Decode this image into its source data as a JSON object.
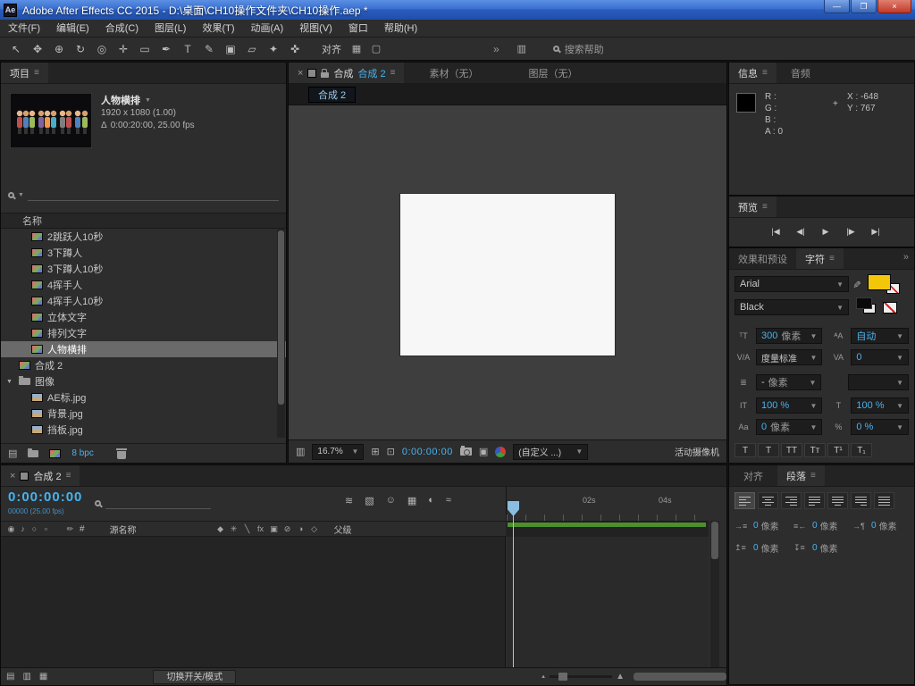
{
  "icons": {
    "menu": "≡",
    "dropdown": "▼",
    "overflow": "»",
    "delta": "Δ",
    "crosshair": "+"
  },
  "titlebar": {
    "app_badge": "Ae",
    "title": "Adobe After Effects CC 2015 - D:\\桌面\\CH10操作文件夹\\CH10操作.aep *",
    "minimize": "—",
    "maximize": "❐",
    "close": "×"
  },
  "menubar": {
    "items": [
      "文件(F)",
      "编辑(E)",
      "合成(C)",
      "图层(L)",
      "效果(T)",
      "动画(A)",
      "视图(V)",
      "窗口",
      "帮助(H)"
    ]
  },
  "toolbar": {
    "tools": [
      {
        "name": "selection-tool",
        "glyph": "↖"
      },
      {
        "name": "hand-tool",
        "glyph": "✥"
      },
      {
        "name": "zoom-tool",
        "glyph": "⊕"
      },
      {
        "name": "rotation-tool",
        "glyph": "↻"
      },
      {
        "name": "unified-camera-tool",
        "glyph": "◎"
      },
      {
        "name": "pan-behind-tool",
        "glyph": "✛"
      },
      {
        "name": "shape-tool",
        "glyph": "▭"
      },
      {
        "name": "pen-tool",
        "glyph": "✒"
      },
      {
        "name": "type-tool",
        "glyph": "T"
      },
      {
        "name": "brush-tool",
        "glyph": "✎"
      },
      {
        "name": "clone-stamp-tool",
        "glyph": "▣"
      },
      {
        "name": "eraser-tool",
        "glyph": "▱"
      },
      {
        "name": "roto-brush-tool",
        "glyph": "✦"
      },
      {
        "name": "puppet-pin-tool",
        "glyph": "✜"
      }
    ],
    "align_label": "对齐",
    "right_icons": [
      {
        "name": "grid-icon",
        "glyph": "▦"
      },
      {
        "name": "guides-icon",
        "glyph": "▢"
      }
    ],
    "workspace_icon": "▥",
    "search_text": "搜索帮助"
  },
  "project": {
    "tab": "项目",
    "preview": {
      "name": "人物横排",
      "dims": "1920 x 1080 (1.00)",
      "duration": "0:00:20:00, 25.00 fps"
    },
    "name_column": "名称",
    "items": [
      {
        "name": "2跳跃人10秒",
        "type": "comp",
        "indent": 1
      },
      {
        "name": "3下蹲人",
        "type": "comp",
        "indent": 1
      },
      {
        "name": "3下蹲人10秒",
        "type": "comp",
        "indent": 1
      },
      {
        "name": "4挥手人",
        "type": "comp",
        "indent": 1
      },
      {
        "name": "4挥手人10秒",
        "type": "comp",
        "indent": 1
      },
      {
        "name": "立体文字",
        "type": "comp",
        "indent": 1
      },
      {
        "name": "排列文字",
        "type": "comp",
        "indent": 1
      },
      {
        "name": "人物横排",
        "type": "comp",
        "indent": 1,
        "selected": true
      },
      {
        "name": "合成 2",
        "type": "comp",
        "indent": 0
      },
      {
        "name": "图像",
        "type": "folder",
        "indent": 0
      },
      {
        "name": "AE标.jpg",
        "type": "footage",
        "indent": 1
      },
      {
        "name": "背景.jpg",
        "type": "footage",
        "indent": 1
      },
      {
        "name": "挡板.jpg",
        "type": "footage",
        "indent": 1
      }
    ],
    "bpc": "8 bpc"
  },
  "comp": {
    "close": "×",
    "tab_prefix": "合成",
    "tab_name": "合成 2",
    "tab_footage": "素材（无）",
    "tab_layers": "图层（无）",
    "subtab": "合成 2",
    "zoom": "16.7%",
    "timecode": "0:00:00:00",
    "custom": "(自定义 ...)",
    "camera": "活动摄像机"
  },
  "info": {
    "tab": "信息",
    "tab_audio": "音频",
    "r": "R :",
    "g": "G :",
    "b": "B :",
    "a": "A : 0",
    "x": "X : -648",
    "y": "Y : 767"
  },
  "preview_panel": {
    "tab": "预览",
    "buttons": [
      {
        "name": "first-frame-button",
        "glyph": "|◀"
      },
      {
        "name": "previous-frame-button",
        "glyph": "◀|"
      },
      {
        "name": "play-button",
        "glyph": "▶"
      },
      {
        "name": "next-frame-button",
        "glyph": "|▶"
      },
      {
        "name": "last-frame-button",
        "glyph": "▶|"
      }
    ]
  },
  "character": {
    "tab_effects": "效果和预设",
    "tab": "字符",
    "font_family": "Arial",
    "font_style": "Black",
    "size": {
      "icon": "ᵀT",
      "value": "300",
      "unit": "像素"
    },
    "leading": {
      "icon": "ᴬA",
      "value": "自动"
    },
    "kerning": {
      "icon": "V/A",
      "value": "度量标准"
    },
    "tracking": {
      "icon": "VA",
      "value": "0"
    },
    "stroke_width": {
      "icon": "≣",
      "value": "-",
      "unit": "像素"
    },
    "vertical_scale": {
      "icon": "IT",
      "value": "100 %"
    },
    "horizontal_scale": {
      "icon": "T",
      "value": "100 %"
    },
    "baseline_shift": {
      "icon": "Aa",
      "value": "0",
      "unit": "像素"
    },
    "tsume": {
      "icon": "%",
      "value": "0 %"
    },
    "faux_styles": [
      {
        "name": "faux-bold-button",
        "glyph": "T"
      },
      {
        "name": "faux-italic-button",
        "glyph": "T"
      },
      {
        "name": "all-caps-button",
        "glyph": "TT"
      },
      {
        "name": "small-caps-button",
        "glyph": "Tᴛ"
      },
      {
        "name": "superscript-button",
        "glyph": "T¹"
      },
      {
        "name": "subscript-button",
        "glyph": "T₁"
      }
    ]
  },
  "paragraph": {
    "tab_align": "对齐",
    "tab": "段落",
    "align_buttons": [
      {
        "name": "align-left-button",
        "type": "left",
        "selected": true
      },
      {
        "name": "align-center-button",
        "type": "center"
      },
      {
        "name": "align-right-button",
        "type": "right"
      },
      {
        "name": "justify-last-left-button",
        "type": "jleft"
      },
      {
        "name": "justify-last-center-button",
        "type": "jcenter"
      },
      {
        "name": "justify-last-right-button",
        "type": "jright"
      },
      {
        "name": "justify-all-button",
        "type": "jall"
      }
    ],
    "fields": [
      {
        "name": "indent-left-field",
        "icon": "→≡",
        "value": "0",
        "unit": "像素"
      },
      {
        "name": "indent-right-field",
        "icon": "≡←",
        "value": "0",
        "unit": "像素"
      },
      {
        "name": "first-line-indent-field",
        "icon": "→¶",
        "value": "0",
        "unit": "像素"
      },
      {
        "name": "space-before-field",
        "icon": "↥≡",
        "value": "0",
        "unit": "像素"
      },
      {
        "name": "space-after-field",
        "icon": "↧≡",
        "value": "0",
        "unit": "像素"
      }
    ]
  },
  "timeline": {
    "close": "×",
    "tab": "合成 2",
    "timecode": "0:00:00:00",
    "frame_info": "00000 (25.00 fps)",
    "buttons": [
      {
        "name": "comp-mini-flowchart-icon",
        "glyph": "≋"
      },
      {
        "name": "draft-3d-icon",
        "glyph": "▧"
      },
      {
        "name": "hide-shy-layers-icon",
        "glyph": "☺"
      },
      {
        "name": "frame-blending-icon",
        "glyph": "▦"
      },
      {
        "name": "motion-blur-icon",
        "glyph": "◐"
      },
      {
        "name": "graph-editor-icon",
        "glyph": "≈"
      }
    ],
    "header": {
      "left_icons": [
        {
          "name": "video-column-icon",
          "glyph": "◉"
        },
        {
          "name": "audio-column-icon",
          "glyph": "♪"
        },
        {
          "name": "solo-column-icon",
          "glyph": "○"
        },
        {
          "name": "lock-column-icon",
          "glyph": "▫"
        }
      ],
      "label_icon": "✏",
      "index": "#",
      "source": "源名称",
      "switches": [
        {
          "name": "quality-switch-icon",
          "glyph": "◆"
        },
        {
          "name": "effects-switch-icon",
          "glyph": "✳"
        },
        {
          "name": "frame-blend-switch-icon",
          "glyph": "╲"
        },
        {
          "name": "fx-switch-icon",
          "glyph": "fx"
        },
        {
          "name": "adjustment-layer-switch-icon",
          "glyph": "▣"
        },
        {
          "name": "mute-switch-icon",
          "glyph": "⊘"
        },
        {
          "name": "motion-blur-switch-icon",
          "glyph": "◑"
        },
        {
          "name": "3d-layer-switch-icon",
          "glyph": "◇"
        }
      ],
      "parent": "父级"
    },
    "ruler": [
      "02s",
      "04s"
    ],
    "bottom_icons": [
      {
        "name": "expand-layer-switches-icon",
        "glyph": "▤"
      },
      {
        "name": "expand-transfer-controls-icon",
        "glyph": "▥"
      },
      {
        "name": "expand-in-out-icon",
        "glyph": "▦"
      }
    ],
    "toggle_modes_button": "切换开关/模式"
  },
  "colors": {
    "accent_cyan": "#49b2ee",
    "workarea_green": "#4c8f2c",
    "fill_yellow": "#f4c60a",
    "titlebar_blue": "#2f64c4",
    "selected_row_gray": "#6a6a6a"
  }
}
